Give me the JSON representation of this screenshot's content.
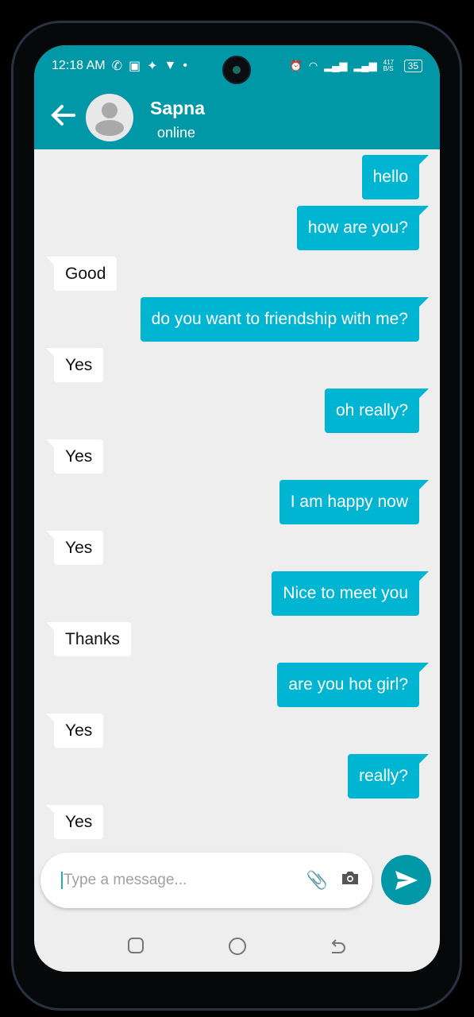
{
  "status_bar": {
    "time": "12:18 AM",
    "net_speed": "417 B/S",
    "battery": "35"
  },
  "header": {
    "contact_name": "Sapna",
    "status": "online"
  },
  "messages": [
    {
      "dir": "sent",
      "text": "hello"
    },
    {
      "dir": "sent",
      "text": "how are you?"
    },
    {
      "dir": "recv",
      "text": "Good"
    },
    {
      "dir": "sent",
      "text": "do you want to friendship with me?"
    },
    {
      "dir": "recv",
      "text": "Yes"
    },
    {
      "dir": "sent",
      "text": "oh really?"
    },
    {
      "dir": "recv",
      "text": "Yes"
    },
    {
      "dir": "sent",
      "text": "I am happy now"
    },
    {
      "dir": "recv",
      "text": "Yes"
    },
    {
      "dir": "sent",
      "text": "Nice to meet you"
    },
    {
      "dir": "recv",
      "text": "Thanks"
    },
    {
      "dir": "sent",
      "text": "are you hot girl?"
    },
    {
      "dir": "recv",
      "text": "Yes"
    },
    {
      "dir": "sent",
      "text": "really?"
    },
    {
      "dir": "recv",
      "text": "Yes"
    }
  ],
  "composer": {
    "placeholder": "Type a message...",
    "value": ""
  },
  "colors": {
    "header": "#0097a7",
    "sent_bubble": "#00b5d1",
    "recv_bubble": "#ffffff",
    "chat_bg": "#efeeef"
  }
}
